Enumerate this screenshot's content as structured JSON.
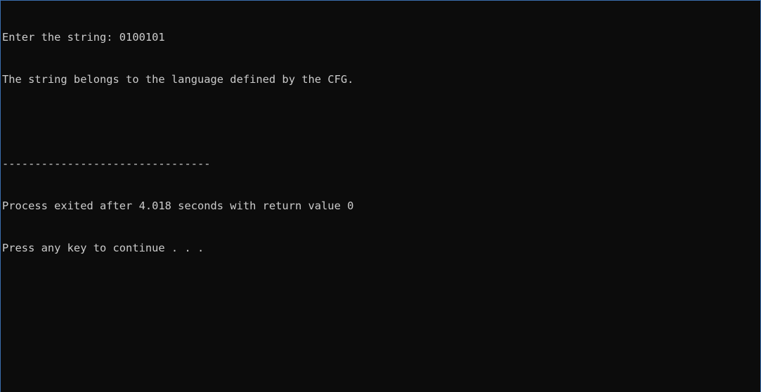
{
  "console": {
    "lines": [
      "Enter the string: 0100101",
      "The string belongs to the language defined by the CFG.",
      "",
      "--------------------------------",
      "Process exited after 4.018 seconds with return value 0",
      "Press any key to continue . . ."
    ]
  },
  "colors": {
    "background": "#0c0c0c",
    "text": "#cccccc",
    "window_border": "#3c6fb0"
  }
}
